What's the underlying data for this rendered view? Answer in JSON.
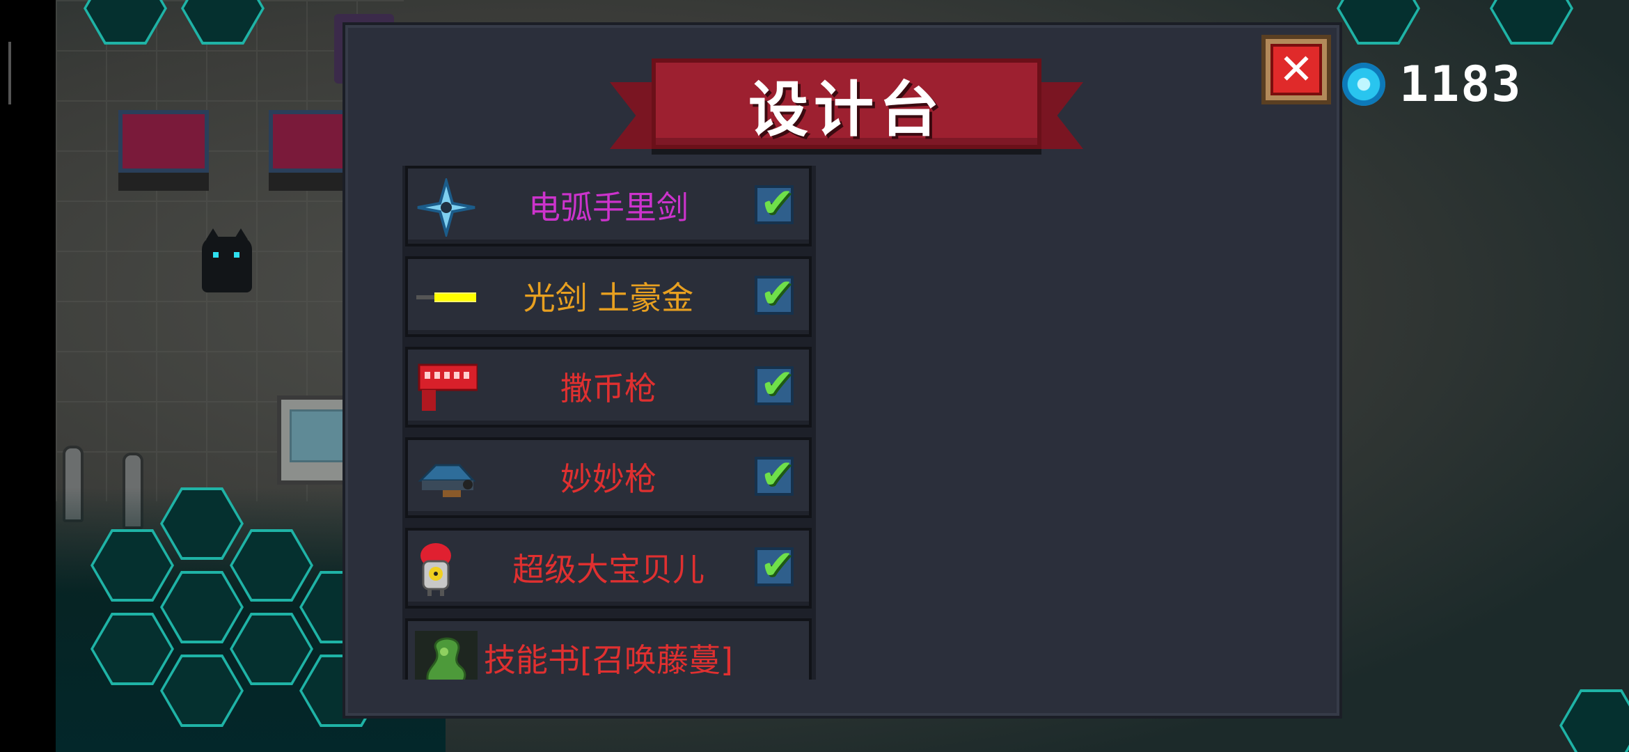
{
  "hud": {
    "gem_icon": "gem-icon",
    "gem_count": "1183"
  },
  "panel": {
    "title": "设计台",
    "close_icon": "close-x-icon",
    "items": [
      {
        "name": "电弧手里剑",
        "color": "#cc33cc",
        "icon": "shuriken-icon",
        "checked": true
      },
      {
        "name": "光剑 土豪金",
        "color": "#e8a020",
        "icon": "lightsaber-icon",
        "checked": true
      },
      {
        "name": "撒币枪",
        "color": "#e03030",
        "icon": "coin-gun-icon",
        "checked": true
      },
      {
        "name": "妙妙枪",
        "color": "#e03030",
        "icon": "magic-gun-icon",
        "checked": true
      },
      {
        "name": "超级大宝贝儿",
        "color": "#e03030",
        "icon": "nuke-bomb-icon",
        "checked": true
      },
      {
        "name": "技能书[召唤藤蔓]",
        "color": "#e03030",
        "icon": "vine-skill-book-icon",
        "checked": false
      }
    ]
  },
  "colors": {
    "panel_bg": "#2b2f3b",
    "banner_red": "#9d2030",
    "check_green": "#6fe04a",
    "hex_teal": "#1fb3a6"
  }
}
